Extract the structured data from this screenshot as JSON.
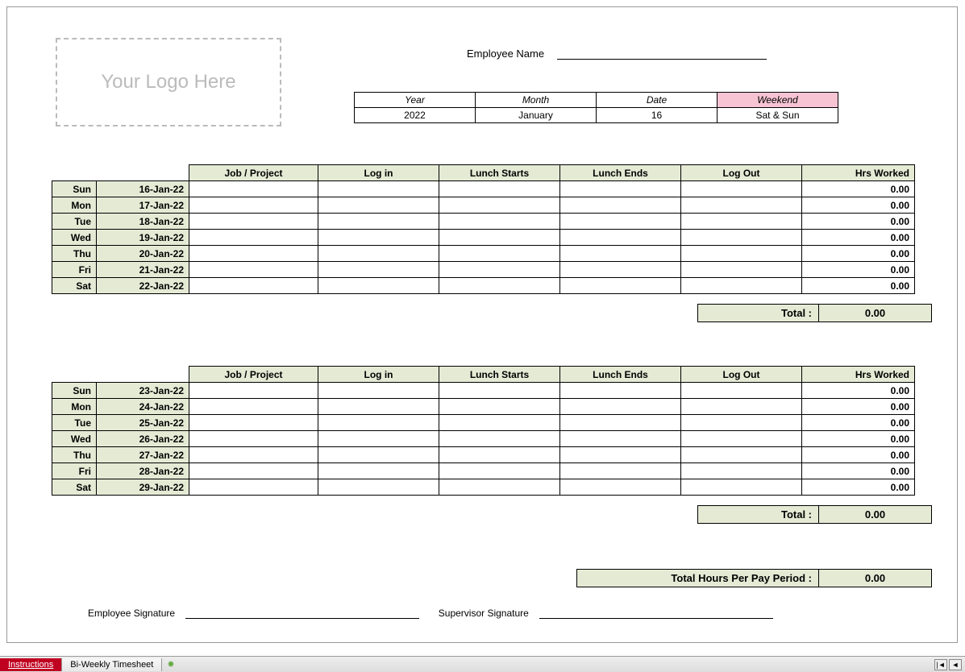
{
  "logo_placeholder": "Your Logo Here",
  "employee_name_label": "Employee Name",
  "meta": {
    "headers": {
      "year": "Year",
      "month": "Month",
      "date": "Date",
      "weekend": "Weekend"
    },
    "values": {
      "year": "2022",
      "month": "January",
      "date": "16",
      "weekend": "Sat & Sun"
    }
  },
  "columns": {
    "job": "Job / Project",
    "login": "Log in",
    "lunch_start": "Lunch Starts",
    "lunch_end": "Lunch Ends",
    "logout": "Log Out",
    "hrs": "Hrs Worked"
  },
  "week1": [
    {
      "day": "Sun",
      "date": "16-Jan-22",
      "hrs": "0.00"
    },
    {
      "day": "Mon",
      "date": "17-Jan-22",
      "hrs": "0.00"
    },
    {
      "day": "Tue",
      "date": "18-Jan-22",
      "hrs": "0.00"
    },
    {
      "day": "Wed",
      "date": "19-Jan-22",
      "hrs": "0.00"
    },
    {
      "day": "Thu",
      "date": "20-Jan-22",
      "hrs": "0.00"
    },
    {
      "day": "Fri",
      "date": "21-Jan-22",
      "hrs": "0.00"
    },
    {
      "day": "Sat",
      "date": "22-Jan-22",
      "hrs": "0.00"
    }
  ],
  "week2": [
    {
      "day": "Sun",
      "date": "23-Jan-22",
      "hrs": "0.00"
    },
    {
      "day": "Mon",
      "date": "24-Jan-22",
      "hrs": "0.00"
    },
    {
      "day": "Tue",
      "date": "25-Jan-22",
      "hrs": "0.00"
    },
    {
      "day": "Wed",
      "date": "26-Jan-22",
      "hrs": "0.00"
    },
    {
      "day": "Thu",
      "date": "27-Jan-22",
      "hrs": "0.00"
    },
    {
      "day": "Fri",
      "date": "28-Jan-22",
      "hrs": "0.00"
    },
    {
      "day": "Sat",
      "date": "29-Jan-22",
      "hrs": "0.00"
    }
  ],
  "totals": {
    "week_label": "Total :",
    "week1_value": "0.00",
    "week2_value": "0.00",
    "grand_label": "Total Hours Per Pay Period :",
    "grand_value": "0.00"
  },
  "signatures": {
    "employee": "Employee Signature",
    "supervisor": "Supervisor Signature"
  },
  "tabs": {
    "instructions": "Instructions",
    "timesheet": "Bi-Weekly Timesheet"
  },
  "scroll": {
    "first": "|◄",
    "prev": "◄"
  }
}
